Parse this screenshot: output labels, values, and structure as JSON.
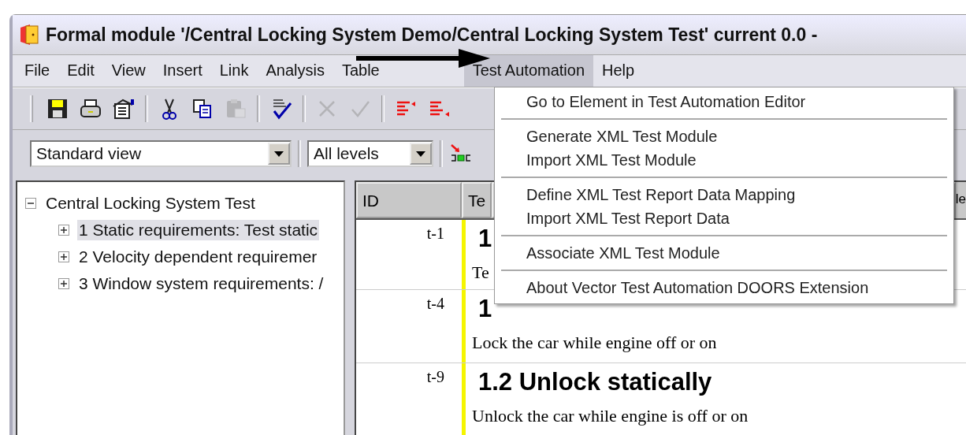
{
  "window": {
    "title": "Formal module '/Central Locking System Demo/Central Locking System Test' current 0.0 -"
  },
  "menu_bar": [
    {
      "label": "File",
      "selected": false
    },
    {
      "label": "Edit",
      "selected": false
    },
    {
      "label": "View",
      "selected": false
    },
    {
      "label": "Insert",
      "selected": false
    },
    {
      "label": "Link",
      "selected": false
    },
    {
      "label": "Analysis",
      "selected": false
    },
    {
      "label": "Table",
      "selected": false
    },
    {
      "label": "Test Automation",
      "selected": true
    },
    {
      "label": "Help",
      "selected": false
    }
  ],
  "toolbar": [
    {
      "kind": "save",
      "disabled": false
    },
    {
      "kind": "print",
      "disabled": false
    },
    {
      "kind": "properties",
      "disabled": false
    },
    {
      "kind": "separator"
    },
    {
      "kind": "cut",
      "disabled": false
    },
    {
      "kind": "copy",
      "disabled": false
    },
    {
      "kind": "paste",
      "disabled": true
    },
    {
      "kind": "separator"
    },
    {
      "kind": "spellcheck",
      "disabled": false
    },
    {
      "kind": "separator"
    },
    {
      "kind": "cancel",
      "disabled": true
    },
    {
      "kind": "confirm",
      "disabled": true
    },
    {
      "kind": "separator"
    },
    {
      "kind": "list-left",
      "disabled": false
    },
    {
      "kind": "list-right",
      "disabled": false
    }
  ],
  "view_bar": {
    "view": "Standard view",
    "levels": "All levels"
  },
  "tree": {
    "label": "Central Locking System Test",
    "expanded": true,
    "selected": false,
    "children": [
      {
        "label": "1 Static requirements: Test static",
        "expanded": false,
        "selected": true
      },
      {
        "label": "2 Velocity dependent requiremer",
        "expanded": false,
        "selected": false
      },
      {
        "label": "3 Window system requirements: /",
        "expanded": false,
        "selected": false
      }
    ]
  },
  "table": {
    "columns": [
      "ID",
      "Te",
      "le"
    ],
    "rows": [
      {
        "id": "t-1",
        "heading": "1",
        "text": "Te"
      },
      {
        "id": "t-4",
        "heading": "1",
        "text": "Lock the car while engine off or on"
      },
      {
        "id": "t-9",
        "heading": "1.2 Unlock statically",
        "text": "Unlock the car while engine is off or on"
      }
    ]
  },
  "dropdown_menu": {
    "groups": [
      [
        "Go to Element in Test Automation Editor"
      ],
      [
        "Generate XML Test Module",
        "Import XML Test Module"
      ],
      [
        "Define XML Test Report Data Mapping",
        "Import XML Test Report Data"
      ],
      [
        "Associate XML Test Module"
      ],
      [
        "About Vector Test Automation DOORS Extension"
      ]
    ]
  }
}
